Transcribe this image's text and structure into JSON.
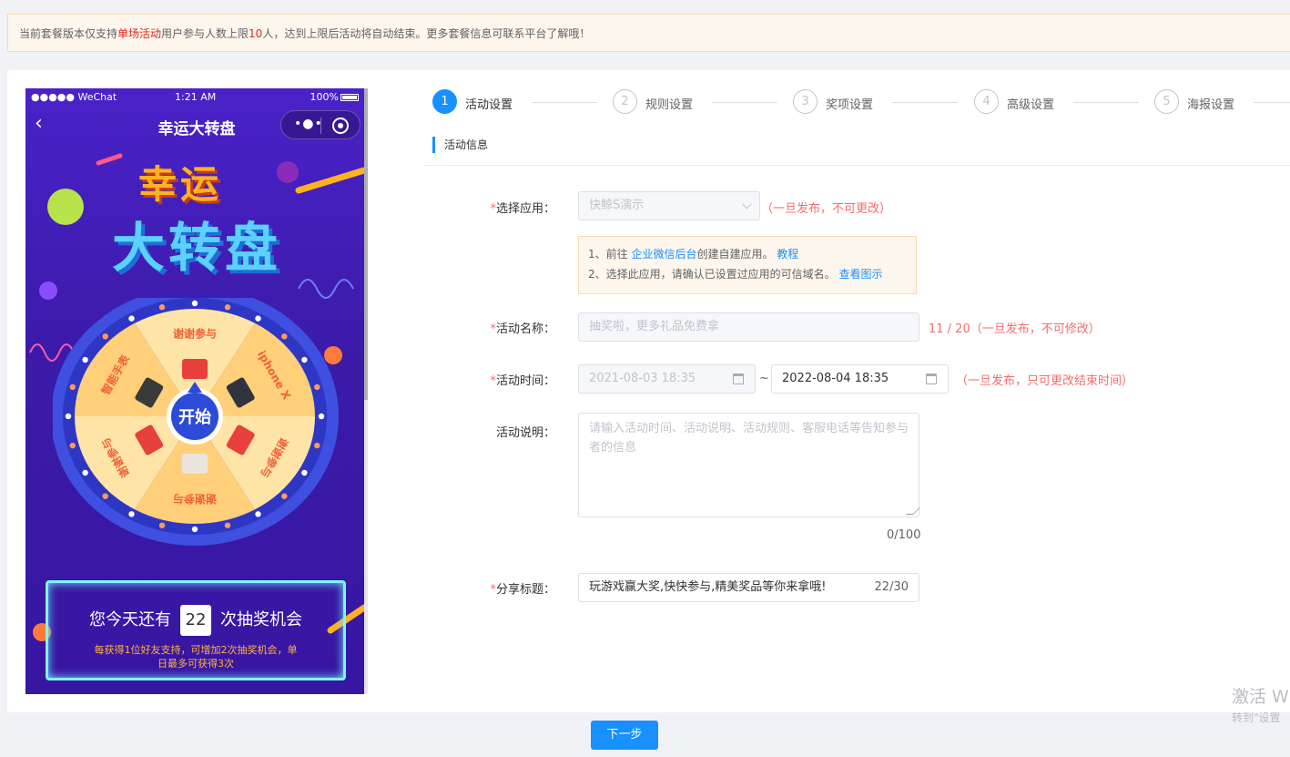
{
  "notice": {
    "pre": "当前套餐版本仅支持",
    "highlight1": "单场活动",
    "mid": "用户参与人数上限",
    "highlight2": "10",
    "post": "人，达到上限后活动将自动结束。更多套餐信息可联系平台了解哦！"
  },
  "phone": {
    "carrier": "●●●●● WeChat",
    "time": "1:21 AM",
    "battery": "100%",
    "nav_title": "幸运大转盘",
    "logo_line1": "幸运",
    "logo_line2": "大转盘",
    "start_label": "开始",
    "prizes": [
      "谢谢参与",
      "iphone X",
      "谢谢参与",
      "谢谢参与",
      "谢谢参与",
      "智能手表"
    ],
    "chances_pre": "您今天还有",
    "chances_num": "22",
    "chances_post": "次抽奖机会",
    "chances_tip": "每获得1位好友支持，可增加2次抽奖机会，单日最多可获得3次"
  },
  "steps": [
    {
      "num": "1",
      "label": "活动设置",
      "active": true
    },
    {
      "num": "2",
      "label": "规则设置",
      "active": false
    },
    {
      "num": "3",
      "label": "奖项设置",
      "active": false
    },
    {
      "num": "4",
      "label": "高级设置",
      "active": false
    },
    {
      "num": "5",
      "label": "海报设置",
      "active": false
    }
  ],
  "section_title": "活动信息",
  "form": {
    "app": {
      "label": "选择应用：",
      "value": "快鲸S演示",
      "hint": "（一旦发布，不可更改）"
    },
    "tips": {
      "line1_pre": "1、前往 ",
      "line1_link": "企业微信后台",
      "line1_post": "创建自建应用。 ",
      "line1_link2": "教程",
      "line2_pre": "2、选择此应用，请确认已设置过应用的可信域名。 ",
      "line2_link": "查看图示"
    },
    "name": {
      "label": "活动名称：",
      "placeholder": "抽奖啦，更多礼品免费拿",
      "count": "11 / 20",
      "hint": "（一旦发布，不可修改）"
    },
    "time": {
      "label": "活动时间：",
      "start": "2021-08-03 18:35",
      "sep": "~",
      "end": "2022-08-04 18:35",
      "hint": "（一旦发布，只可更改结束时间）"
    },
    "desc": {
      "label": "活动说明：",
      "placeholder": "请输入活动时间、活动说明、活动规则、客服电话等告知参与者的信息",
      "count": "0/100"
    },
    "share": {
      "label": "分享标题：",
      "value": "玩游戏赢大奖,快快参与,精美奖品等你来拿哦!",
      "count": "22/30"
    }
  },
  "next_button": "下一步",
  "watermark": {
    "line1": "激活 W",
    "line2": "转到\"设置"
  },
  "colors": {
    "primary": "#1890ff",
    "danger": "#f56c6c",
    "warning_bg": "#fdf6ec"
  }
}
